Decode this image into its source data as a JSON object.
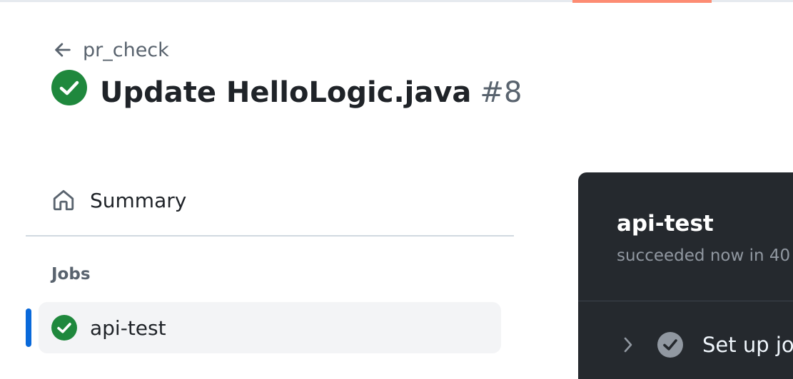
{
  "colors": {
    "success": "#1f883d",
    "accent_blue": "#0969da",
    "accent_orange": "#fd8c73",
    "log_bg": "#25292e"
  },
  "header": {
    "back_label": "pr_check",
    "back_icon": "arrow-left-icon",
    "run_status_icon": "check-circle-fill-icon",
    "title": "Update HelloLogic.java",
    "run_number": "#8"
  },
  "sidebar": {
    "summary_label": "Summary",
    "summary_icon": "home-icon",
    "jobs_heading": "Jobs",
    "jobs": [
      {
        "label": "api-test",
        "status_icon": "check-circle-fill-icon",
        "active": true
      }
    ]
  },
  "log_panel": {
    "job_title": "api-test",
    "status_text": "succeeded now in 40",
    "steps": [
      {
        "label": "Set up jo",
        "chevron_icon": "chevron-right-icon",
        "status_icon": "check-circle-icon"
      }
    ]
  }
}
